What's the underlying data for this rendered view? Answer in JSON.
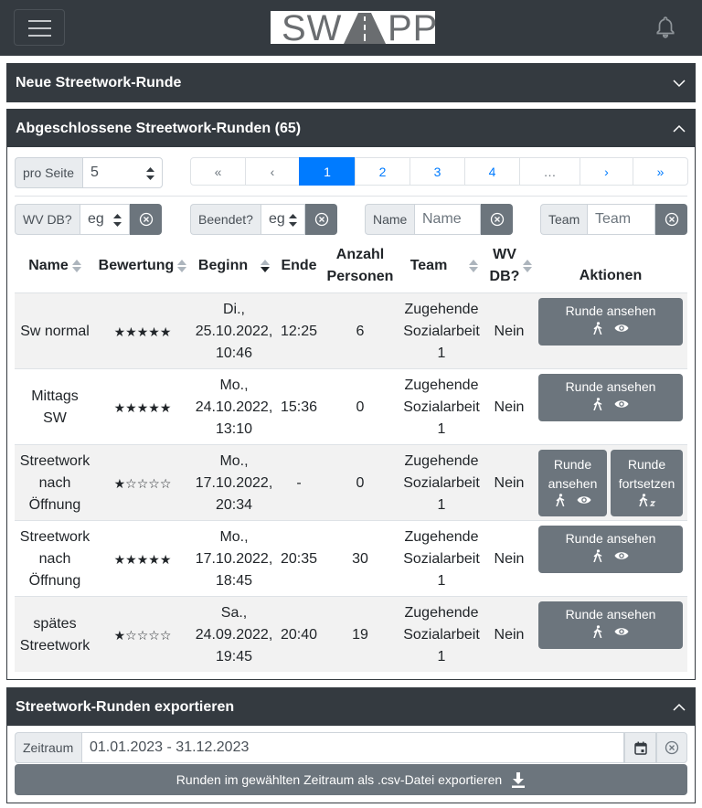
{
  "app": {
    "logo_text": "SW  PP"
  },
  "sections": {
    "new_round": "Neue Streetwork-Runde",
    "completed_rounds": "Abgeschlossene Streetwork-Runden (65)",
    "export": "Streetwork-Runden exportieren"
  },
  "per_page": {
    "label": "pro Seite",
    "value": "5"
  },
  "pagination": [
    "«",
    "‹",
    "1",
    "2",
    "3",
    "4",
    "…",
    "›",
    "»"
  ],
  "pagination_active": "1",
  "filters": {
    "wv_db": {
      "label": "WV DB?",
      "value": "eg"
    },
    "ended": {
      "label": "Beendet?",
      "value": "eg"
    },
    "name": {
      "label": "Name",
      "placeholder": "Name"
    },
    "team": {
      "label": "Team",
      "placeholder": "Team"
    }
  },
  "table": {
    "headers": {
      "name": "Name",
      "rating": "Bewertung",
      "begin": "Beginn",
      "end": "Ende",
      "persons_l1": "Anzahl",
      "persons_l2": "Personen",
      "team": "Team",
      "wvdb_l1": "WV",
      "wvdb_l2": "DB?",
      "actions": "Aktionen"
    },
    "rows": [
      {
        "name_l1": "Sw normal",
        "name_l2": "",
        "name_l3": "",
        "stars": "★★★★★",
        "begin_l1": "Di.,",
        "begin_l2": "25.10.2022,",
        "begin_l3": "10:46",
        "end": "12:25",
        "persons": "6",
        "team_l1": "Zugehende",
        "team_l2": "Sozialarbeit",
        "team_l3": "1",
        "wvdb": "Nein"
      },
      {
        "name_l1": "Mittags",
        "name_l2": "SW",
        "name_l3": "",
        "stars": "★★★★★",
        "begin_l1": "Mo.,",
        "begin_l2": "24.10.2022,",
        "begin_l3": "13:10",
        "end": "15:36",
        "persons": "0",
        "team_l1": "Zugehende",
        "team_l2": "Sozialarbeit",
        "team_l3": "1",
        "wvdb": "Nein"
      },
      {
        "name_l1": "Streetwork",
        "name_l2": "nach",
        "name_l3": "Öffnung",
        "stars": "★☆☆☆☆",
        "begin_l1": "Mo.,",
        "begin_l2": "17.10.2022,",
        "begin_l3": "20:34",
        "end": "-",
        "persons": "0",
        "team_l1": "Zugehende",
        "team_l2": "Sozialarbeit",
        "team_l3": "1",
        "wvdb": "Nein"
      },
      {
        "name_l1": "Streetwork",
        "name_l2": "nach",
        "name_l3": "Öffnung",
        "stars": "★★★★★",
        "begin_l1": "Mo.,",
        "begin_l2": "17.10.2022,",
        "begin_l3": "18:45",
        "end": "20:35",
        "persons": "30",
        "team_l1": "Zugehende",
        "team_l2": "Sozialarbeit",
        "team_l3": "1",
        "wvdb": "Nein"
      },
      {
        "name_l1": "spätes",
        "name_l2": "Streetwork",
        "name_l3": "",
        "stars": "★☆☆☆☆",
        "begin_l1": "Sa.,",
        "begin_l2": "24.09.2022,",
        "begin_l3": "19:45",
        "end": "20:40",
        "persons": "19",
        "team_l1": "Zugehende",
        "team_l2": "Sozialarbeit",
        "team_l3": "1",
        "wvdb": "Nein"
      }
    ],
    "view_button": "Runde ansehen",
    "view_button_l1": "Runde",
    "view_button_l2": "ansehen",
    "continue_button_l1": "Runde",
    "continue_button_l2": "fortsetzen"
  },
  "export": {
    "range_label": "Zeitraum",
    "range_value": "01.01.2023 - 31.12.2023",
    "button": "Runden im gewählten Zeitraum als .csv-Datei exportieren"
  },
  "colors": {
    "dark": "#343a40",
    "primary": "#007bff",
    "secondary": "#6c757d",
    "stripe": "#f2f2f2"
  }
}
